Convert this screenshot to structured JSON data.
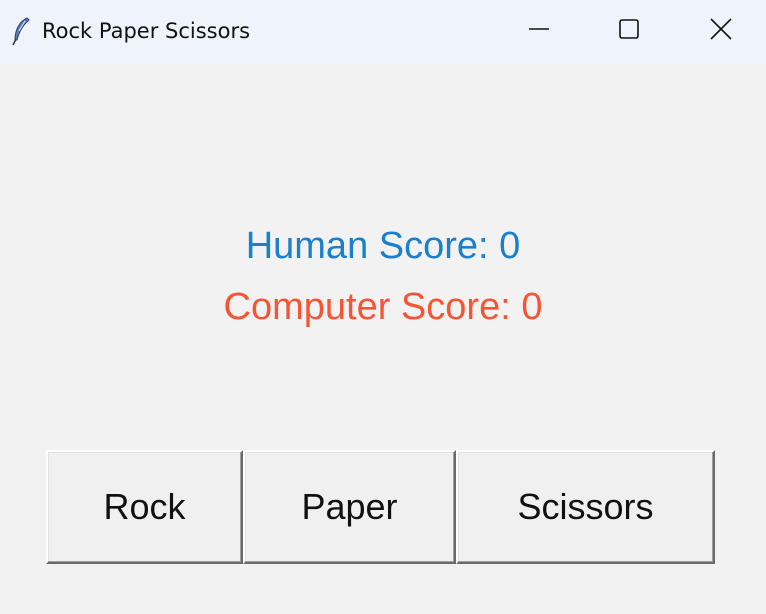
{
  "window": {
    "title": "Rock Paper Scissors",
    "icon": "feather-icon",
    "controls": {
      "minimize": "minimize-icon",
      "maximize": "maximize-icon",
      "close": "close-icon"
    }
  },
  "scores": {
    "human": "Human Score: 0",
    "computer": "Computer Score: 0"
  },
  "buttons": {
    "rock": "Rock",
    "paper": "Paper",
    "scissors": "Scissors"
  },
  "colors": {
    "human_score": "#1a7fcd",
    "computer_score": "#f45535",
    "titlebar": "#eff3fb",
    "background": "#f2f2f2"
  }
}
